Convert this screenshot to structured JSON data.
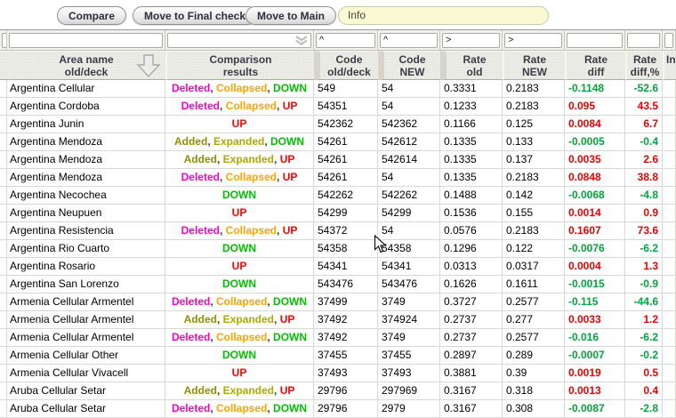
{
  "toolbar": {
    "buttons": [
      "Compare",
      "Move to Final check",
      "Move to Main"
    ],
    "info_value": "Info"
  },
  "table": {
    "filters": [
      "",
      "",
      "",
      "^",
      "^",
      ">",
      ">",
      "",
      "",
      ""
    ],
    "columns": [
      {
        "line1": "",
        "line2": ""
      },
      {
        "line1": "Area name",
        "line2": "old/deck"
      },
      {
        "line1": "Comparison",
        "line2": "results"
      },
      {
        "line1": "Code",
        "line2": "old/deck"
      },
      {
        "line1": "Code",
        "line2": "NEW"
      },
      {
        "line1": "Rate",
        "line2": "old"
      },
      {
        "line1": "Rate",
        "line2": "NEW"
      },
      {
        "line1": "Rate",
        "line2": "diff"
      },
      {
        "line1": "Rate",
        "line2": "diff,%"
      },
      {
        "line1": "In",
        "line2": ""
      }
    ],
    "rows": [
      {
        "area": "Argentina Cellular",
        "comp": [
          [
            "Deleted",
            "deleted"
          ],
          [
            "Collapsed",
            "collapsed"
          ],
          [
            "DOWN",
            "down"
          ]
        ],
        "code_old": "549",
        "code_new": "54",
        "rate_old": "0.3331",
        "rate_new": "0.2183",
        "diff": "-0.1148",
        "pct": "-52.6"
      },
      {
        "area": "Argentina Cordoba",
        "comp": [
          [
            "Deleted",
            "deleted"
          ],
          [
            "Collapsed",
            "collapsed"
          ],
          [
            "UP",
            "up"
          ]
        ],
        "code_old": "54351",
        "code_new": "54",
        "rate_old": "0.1233",
        "rate_new": "0.2183",
        "diff": "0.095",
        "pct": "43.5"
      },
      {
        "area": "Argentina Junin",
        "comp": [
          [
            "UP",
            "up"
          ]
        ],
        "code_old": "542362",
        "code_new": "542362",
        "rate_old": "0.1166",
        "rate_new": "0.125",
        "diff": "0.0084",
        "pct": "6.7"
      },
      {
        "area": "Argentina Mendoza",
        "comp": [
          [
            "Added",
            "added"
          ],
          [
            "Expanded",
            "expanded"
          ],
          [
            "DOWN",
            "down"
          ]
        ],
        "code_old": "54261",
        "code_new": "542612",
        "rate_old": "0.1335",
        "rate_new": "0.133",
        "diff": "-0.0005",
        "pct": "-0.4"
      },
      {
        "area": "Argentina Mendoza",
        "comp": [
          [
            "Added",
            "added"
          ],
          [
            "Expanded",
            "expanded"
          ],
          [
            "UP",
            "up"
          ]
        ],
        "code_old": "54261",
        "code_new": "542614",
        "rate_old": "0.1335",
        "rate_new": "0.137",
        "diff": "0.0035",
        "pct": "2.6"
      },
      {
        "area": "Argentina Mendoza",
        "comp": [
          [
            "Deleted",
            "deleted"
          ],
          [
            "Collapsed",
            "collapsed"
          ],
          [
            "UP",
            "up"
          ]
        ],
        "code_old": "54261",
        "code_new": "54",
        "rate_old": "0.1335",
        "rate_new": "0.2183",
        "diff": "0.0848",
        "pct": "38.8"
      },
      {
        "area": "Argentina Necochea",
        "comp": [
          [
            "DOWN",
            "down"
          ]
        ],
        "code_old": "542262",
        "code_new": "542262",
        "rate_old": "0.1488",
        "rate_new": "0.142",
        "diff": "-0.0068",
        "pct": "-4.8"
      },
      {
        "area": "Argentina Neupuen",
        "comp": [
          [
            "UP",
            "up"
          ]
        ],
        "code_old": "54299",
        "code_new": "54299",
        "rate_old": "0.1536",
        "rate_new": "0.155",
        "diff": "0.0014",
        "pct": "0.9"
      },
      {
        "area": "Argentina Resistencia",
        "comp": [
          [
            "Deleted",
            "deleted"
          ],
          [
            "Collapsed",
            "collapsed"
          ],
          [
            "UP",
            "up"
          ]
        ],
        "code_old": "54372",
        "code_new": "54",
        "rate_old": "0.0576",
        "rate_new": "0.2183",
        "diff": "0.1607",
        "pct": "73.6"
      },
      {
        "area": "Argentina Rio Cuarto",
        "comp": [
          [
            "DOWN",
            "down"
          ]
        ],
        "code_old": "54358",
        "code_new": "54358",
        "rate_old": "0.1296",
        "rate_new": "0.122",
        "diff": "-0.0076",
        "pct": "-6.2"
      },
      {
        "area": "Argentina Rosario",
        "comp": [
          [
            "UP",
            "up"
          ]
        ],
        "code_old": "54341",
        "code_new": "54341",
        "rate_old": "0.0313",
        "rate_new": "0.0317",
        "diff": "0.0004",
        "pct": "1.3"
      },
      {
        "area": "Argentina San Lorenzo",
        "comp": [
          [
            "DOWN",
            "down"
          ]
        ],
        "code_old": "543476",
        "code_new": "543476",
        "rate_old": "0.1626",
        "rate_new": "0.1611",
        "diff": "-0.0015",
        "pct": "-0.9"
      },
      {
        "area": "Armenia Cellular Armentel",
        "comp": [
          [
            "Deleted",
            "deleted"
          ],
          [
            "Collapsed",
            "collapsed"
          ],
          [
            "DOWN",
            "down"
          ]
        ],
        "code_old": "37499",
        "code_new": "3749",
        "rate_old": "0.3727",
        "rate_new": "0.2577",
        "diff": "-0.115",
        "pct": "-44.6"
      },
      {
        "area": "Armenia Cellular Armentel",
        "comp": [
          [
            "Added",
            "added"
          ],
          [
            "Expanded",
            "expanded"
          ],
          [
            "UP",
            "up"
          ]
        ],
        "code_old": "37492",
        "code_new": "374924",
        "rate_old": "0.2737",
        "rate_new": "0.277",
        "diff": "0.0033",
        "pct": "1.2"
      },
      {
        "area": "Armenia Cellular Armentel",
        "comp": [
          [
            "Deleted",
            "deleted"
          ],
          [
            "Collapsed",
            "collapsed"
          ],
          [
            "DOWN",
            "down"
          ]
        ],
        "code_old": "37492",
        "code_new": "3749",
        "rate_old": "0.2737",
        "rate_new": "0.2577",
        "diff": "-0.016",
        "pct": "-6.2"
      },
      {
        "area": "Armenia Cellular Other",
        "comp": [
          [
            "DOWN",
            "down"
          ]
        ],
        "code_old": "37455",
        "code_new": "37455",
        "rate_old": "0.2897",
        "rate_new": "0.289",
        "diff": "-0.0007",
        "pct": "-0.2"
      },
      {
        "area": "Armenia Cellular Vivacell",
        "comp": [
          [
            "UP",
            "up"
          ]
        ],
        "code_old": "37493",
        "code_new": "37493",
        "rate_old": "0.3881",
        "rate_new": "0.39",
        "diff": "0.0019",
        "pct": "0.5"
      },
      {
        "area": "Aruba Cellular Setar",
        "comp": [
          [
            "Added",
            "added"
          ],
          [
            "Expanded",
            "expanded"
          ],
          [
            "UP",
            "up"
          ]
        ],
        "code_old": "29796",
        "code_new": "297969",
        "rate_old": "0.3167",
        "rate_new": "0.318",
        "diff": "0.0013",
        "pct": "0.4"
      },
      {
        "area": "Aruba Cellular Setar",
        "comp": [
          [
            "Deleted",
            "deleted"
          ],
          [
            "Collapsed",
            "collapsed"
          ],
          [
            "DOWN",
            "down"
          ]
        ],
        "code_old": "29796",
        "code_new": "2979",
        "rate_old": "0.3167",
        "rate_new": "0.308",
        "diff": "-0.0087",
        "pct": "-2.8"
      }
    ]
  },
  "colors": {
    "deleted": "#FF00CC",
    "collapsed": "#FFA300",
    "added": "#8F8F00",
    "expanded": "#ABAB00",
    "up": "#FF0000",
    "down": "#00C000",
    "diff_positive": "#EE0000",
    "diff_negative": "#00A53C",
    "info_input_bg": "#FAFAD2"
  }
}
